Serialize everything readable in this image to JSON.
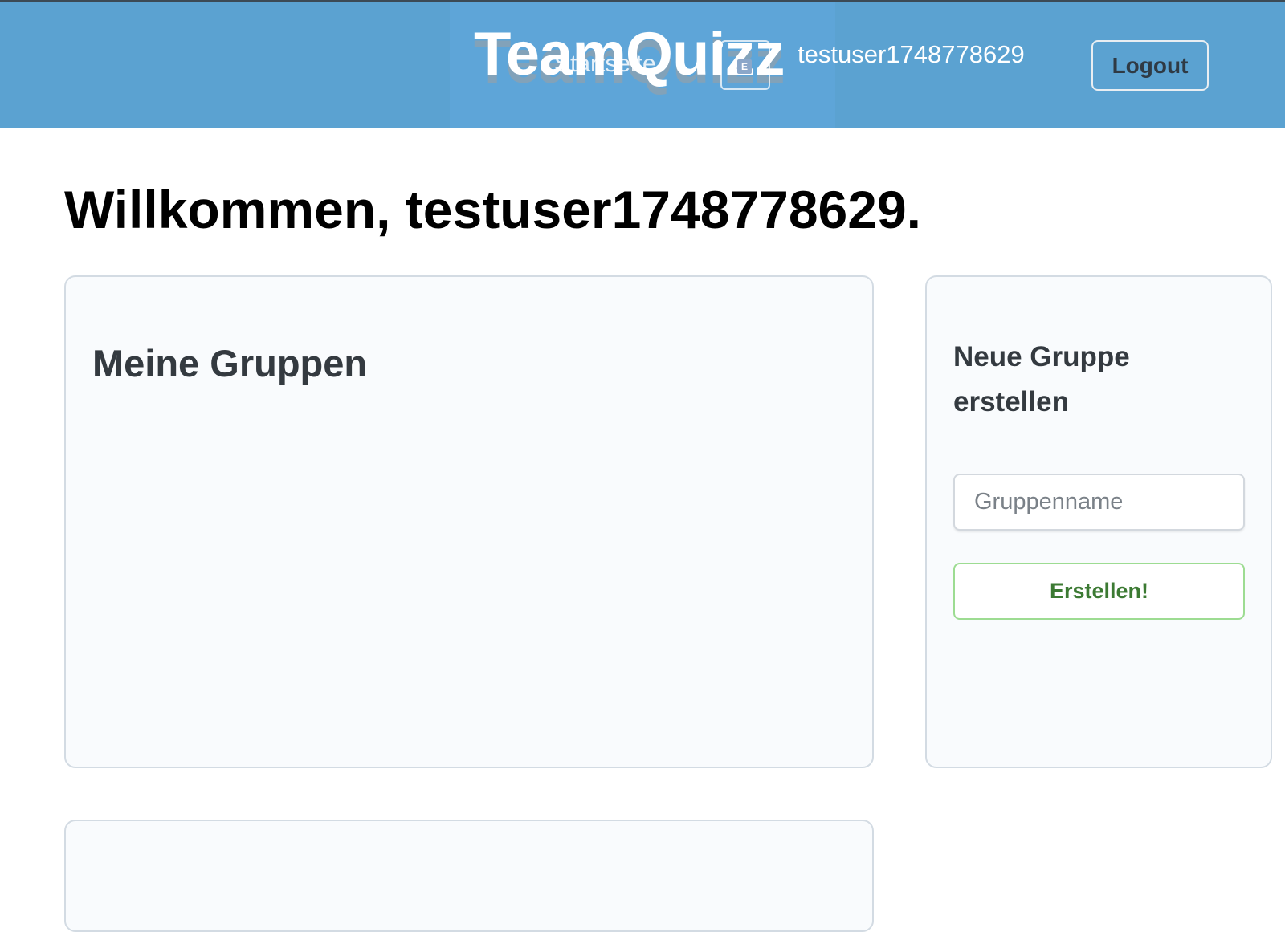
{
  "header": {
    "logo": "TeamQuizz",
    "nav_home": "Startseite",
    "toggle_icon_glyph": "E",
    "username": "testuser1748778629",
    "logout_label": "Logout",
    "background_color": "#5ba2d1"
  },
  "main": {
    "welcome": "Willkommen, testuser1748778629.",
    "groups_card": {
      "title": "Meine Gruppen"
    },
    "create_card": {
      "title": "Neue Gruppe erstellen",
      "input_value": "",
      "input_placeholder": "Gruppenname",
      "submit_label": "Erstellen!",
      "submit_color": "#3c7a33"
    }
  }
}
